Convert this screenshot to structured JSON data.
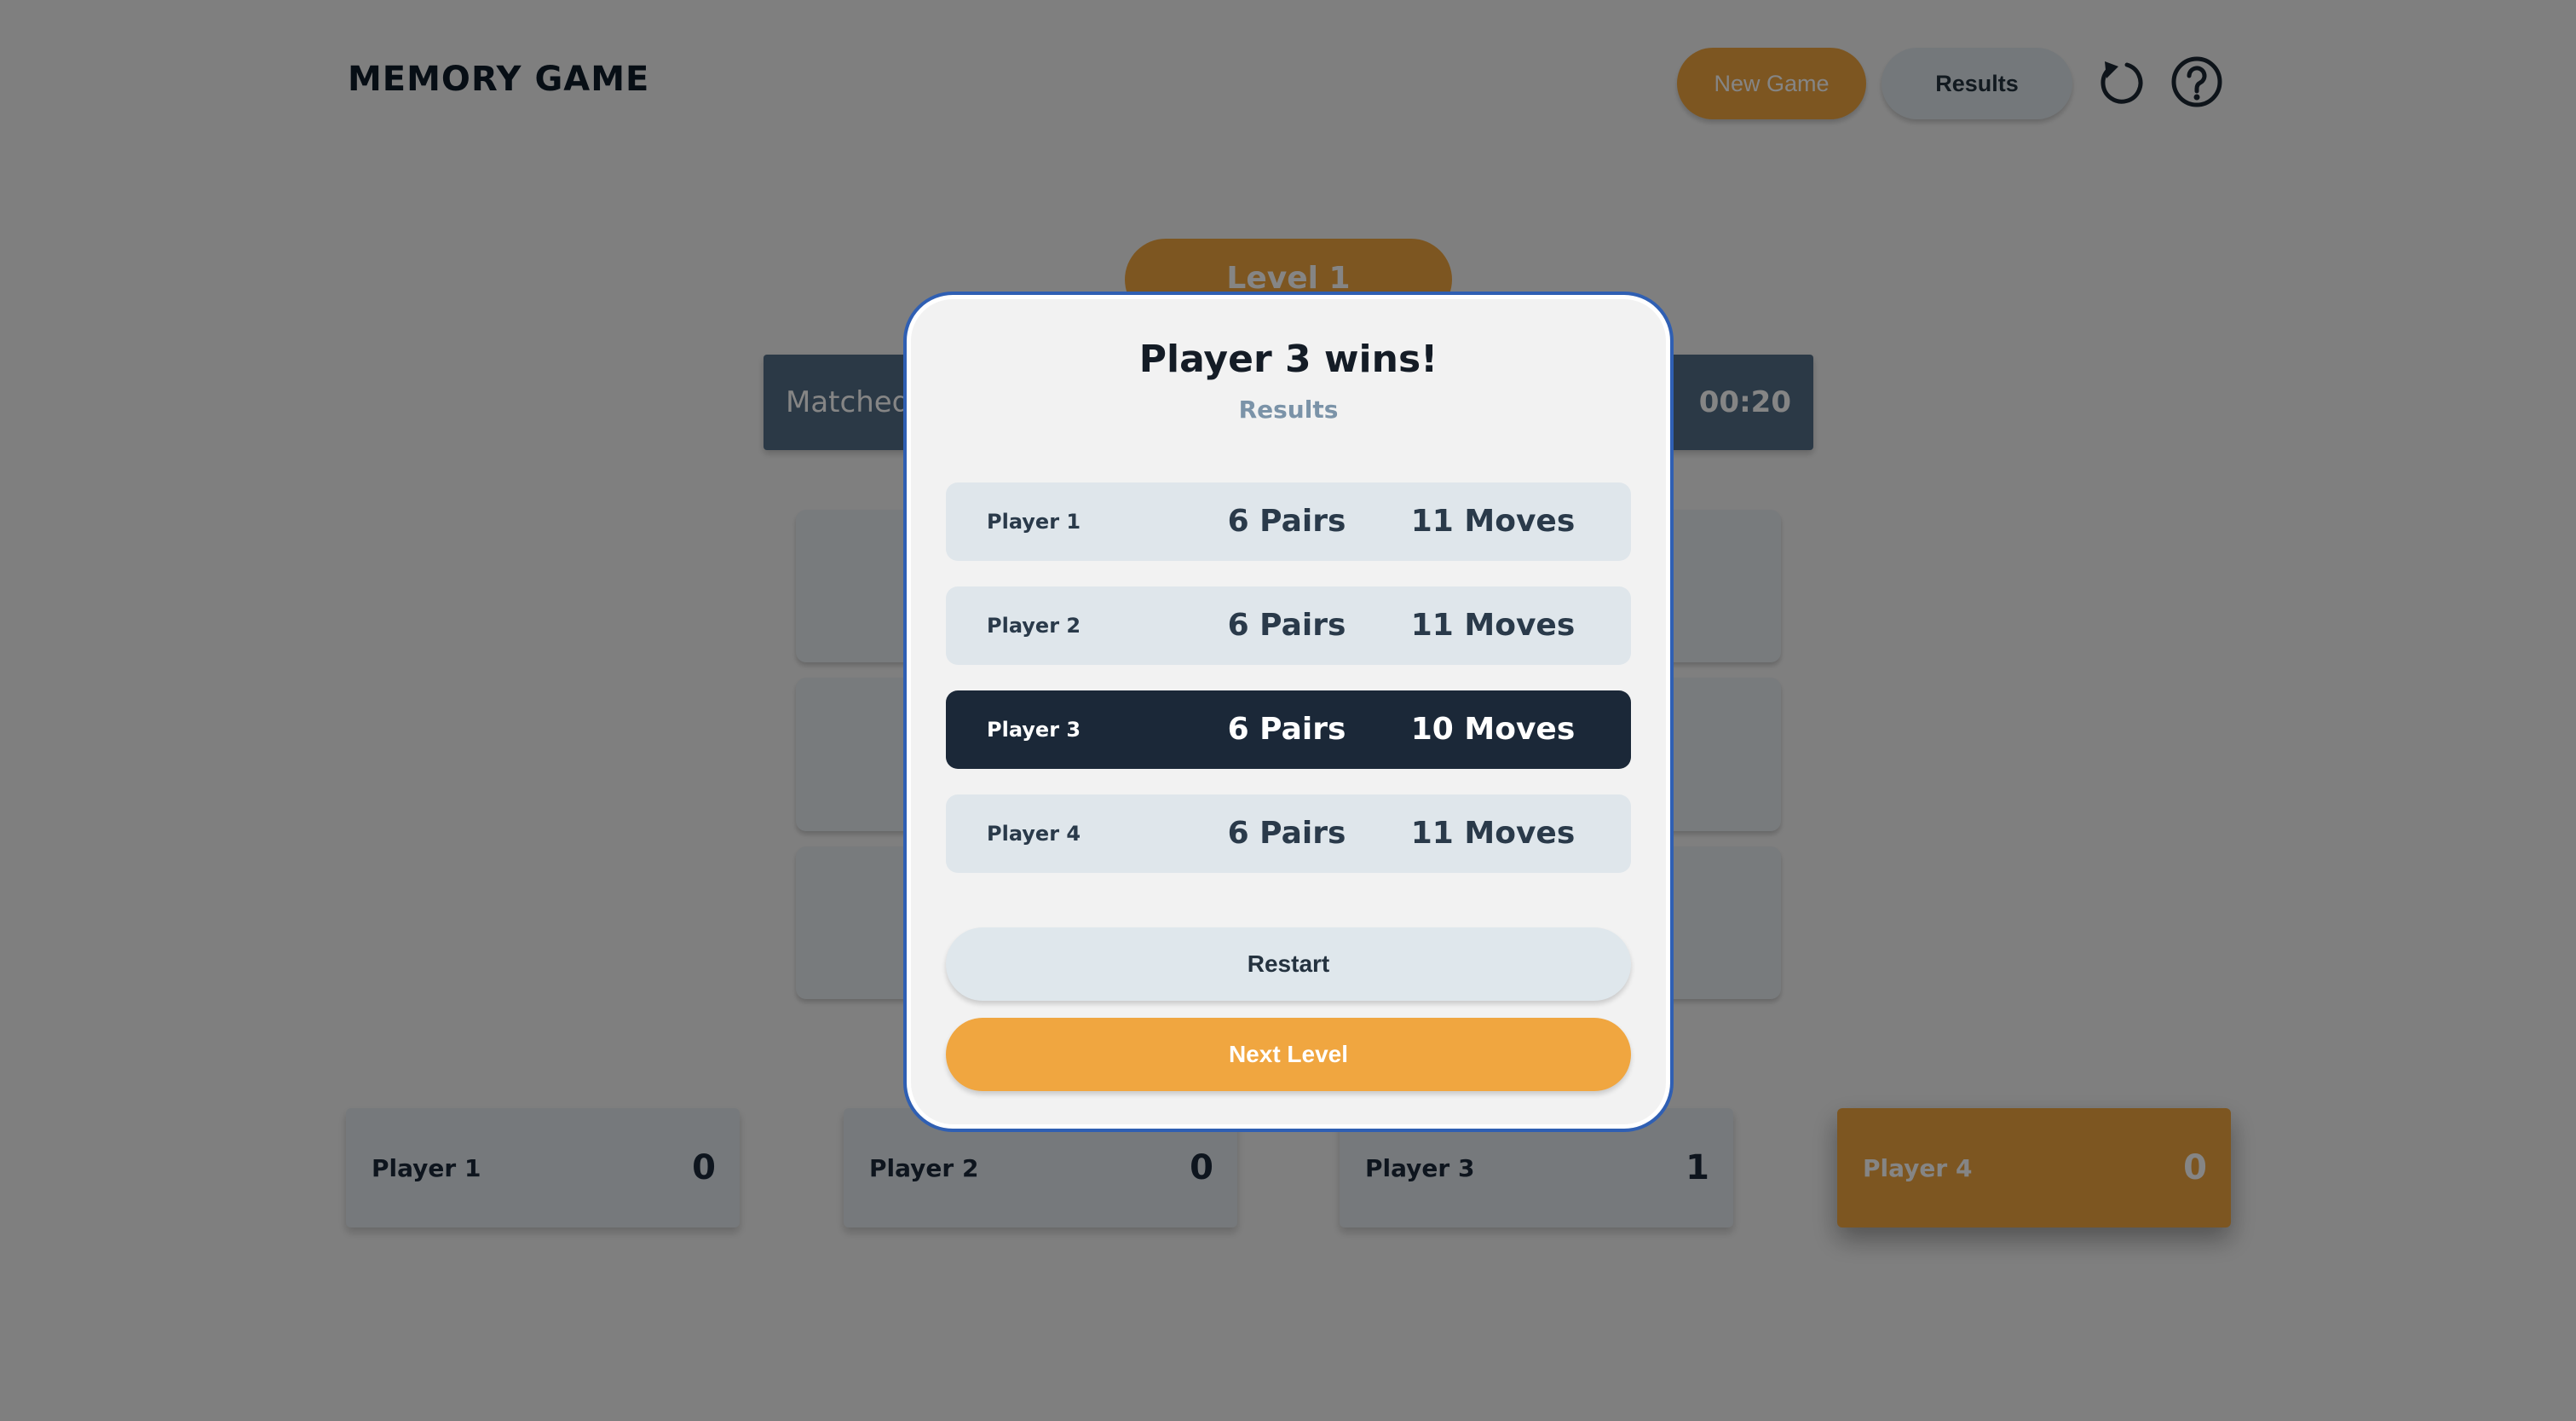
{
  "app": {
    "title": "MEMORY GAME"
  },
  "header": {
    "new_game_label": "New Game",
    "results_label": "Results",
    "restart_icon": "restart-icon",
    "help_icon": "help-icon"
  },
  "game": {
    "level_label": "Level 1",
    "matched_label": "Matched",
    "timer": "00:20",
    "card_count": 15
  },
  "players": [
    {
      "name": "Player 1",
      "score": "0"
    },
    {
      "name": "Player 2",
      "score": "0"
    },
    {
      "name": "Player 3",
      "score": "1"
    },
    {
      "name": "Player 4",
      "score": "0"
    }
  ],
  "modal": {
    "title": "Player 3 wins!",
    "subtitle": "Results",
    "results": [
      {
        "player": "Player 1",
        "pairs": "6 Pairs",
        "moves": "11 Moves"
      },
      {
        "player": "Player 2",
        "pairs": "6 Pairs",
        "moves": "11 Moves"
      },
      {
        "player": "Player 3",
        "pairs": "6 Pairs",
        "moves": "10 Moves"
      },
      {
        "player": "Player 4",
        "pairs": "6 Pairs",
        "moves": "11 Moves"
      }
    ],
    "restart_label": "Restart",
    "next_level_label": "Next Level"
  },
  "colors": {
    "accent": "#f0a640",
    "navy": "#1b2838",
    "slate": "#546e86",
    "modal_border": "#2f5fb3"
  }
}
